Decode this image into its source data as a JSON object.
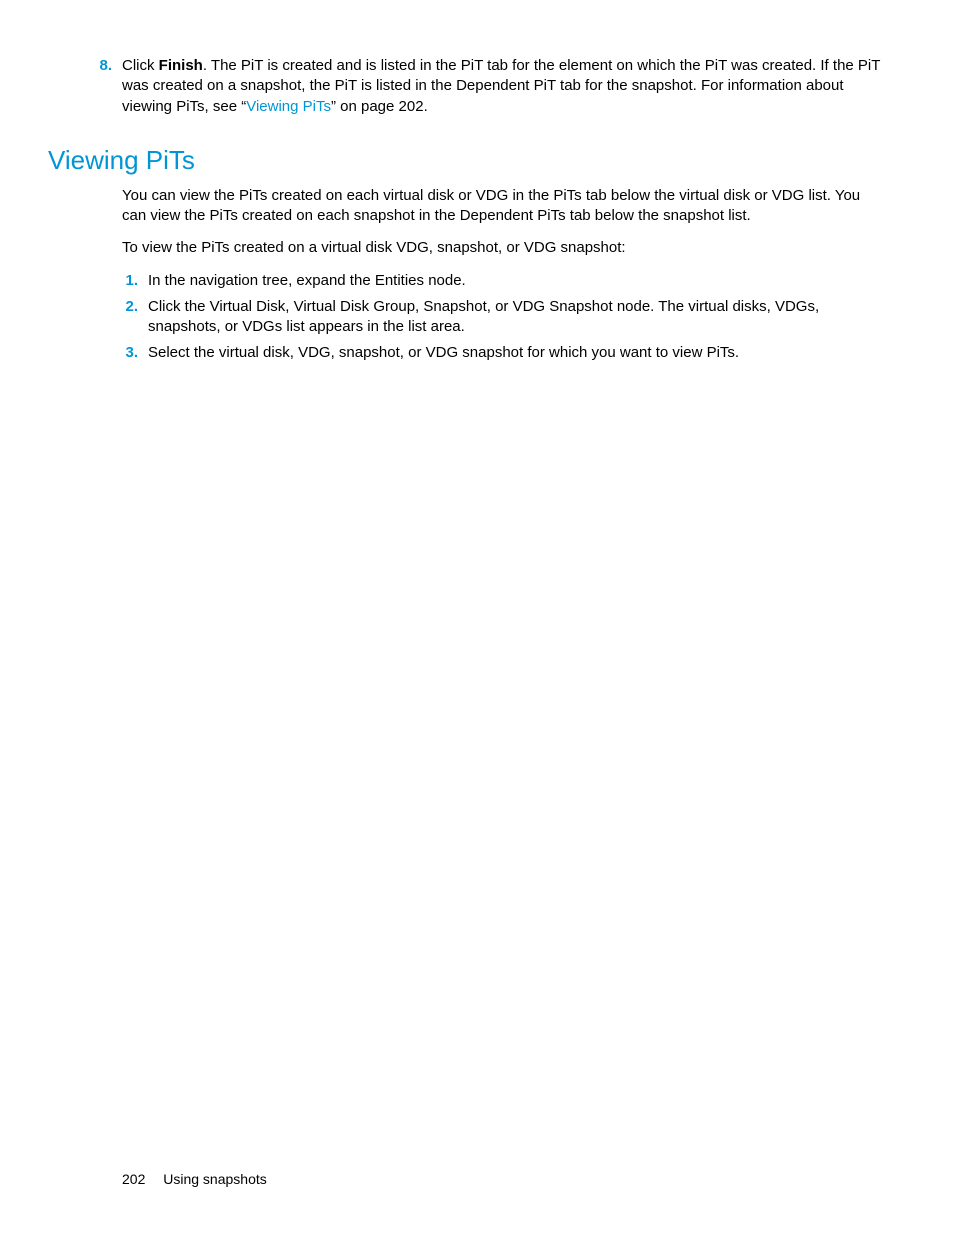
{
  "step8": {
    "num": "8.",
    "pre": "Click ",
    "bold": "Finish",
    "post1": ". The PiT is created and is listed in the PiT tab for the element on which the PiT was created. If the PiT was created on a snapshot, the PiT is listed in the Dependent PiT tab for the snapshot. For information about viewing PiTs, see “",
    "link": "Viewing PiTs",
    "post2": "” on page 202."
  },
  "heading": "Viewing PiTs",
  "para1": "You can view the PiTs created on each virtual disk or VDG in the PiTs tab below the virtual disk or VDG list. You can view the PiTs created on each snapshot in the Dependent PiTs tab below the snapshot list.",
  "para2": "To view the PiTs created on a virtual disk VDG, snapshot, or VDG snapshot:",
  "step1": {
    "num": "1.",
    "txt": "In the navigation tree, expand the Entities node."
  },
  "step2": {
    "num": "2.",
    "txt": "Click the Virtual Disk, Virtual Disk Group, Snapshot, or VDG Snapshot node. The virtual disks, VDGs, snapshots, or VDGs list appears in the list area."
  },
  "step3": {
    "num": "3.",
    "txt": "Select the virtual disk, VDG, snapshot, or VDG snapshot for which you want to view PiTs."
  },
  "footer": {
    "page": "202",
    "section": "Using snapshots"
  }
}
